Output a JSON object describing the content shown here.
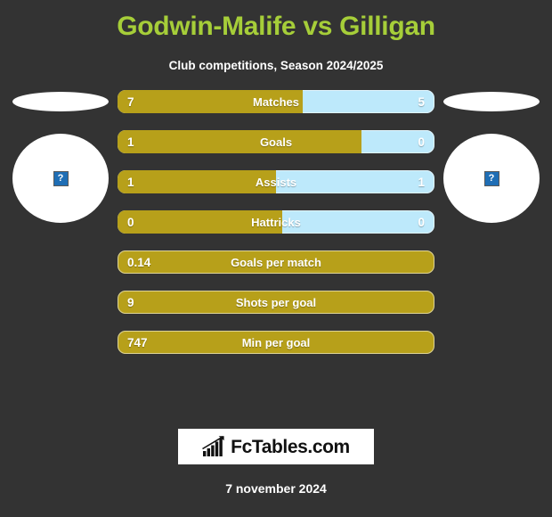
{
  "header": {
    "title": "Godwin-Malife vs Gilligan",
    "subtitle": "Club competitions, Season 2024/2025"
  },
  "colors": {
    "background": "#333333",
    "title": "#a6ce39",
    "home_bar": "#b7a01a",
    "away_bar": "#bde9fb",
    "text": "#ffffff",
    "plate": "#ffffff"
  },
  "players": {
    "home": {
      "name": "",
      "photo_placeholder": "broken-image",
      "photo_alt": "?"
    },
    "away": {
      "name": "",
      "photo_placeholder": "broken-image",
      "photo_alt": "?"
    }
  },
  "chart_data": {
    "type": "bar",
    "title": "Godwin-Malife vs Gilligan",
    "subtitle": "Club competitions, Season 2024/2025",
    "orientation": "horizontal-diverging",
    "series": [
      {
        "name": "Godwin-Malife",
        "side": "home",
        "color": "#b7a01a"
      },
      {
        "name": "Gilligan",
        "side": "away",
        "color": "#bde9fb"
      }
    ],
    "categories": [
      "Matches",
      "Goals",
      "Assists",
      "Hattricks",
      "Goals per match",
      "Shots per goal",
      "Min per goal"
    ],
    "rows": [
      {
        "label": "Matches",
        "home": "7",
        "away": "5",
        "home_pct": 58.3,
        "two_sided": true
      },
      {
        "label": "Goals",
        "home": "1",
        "away": "0",
        "home_pct": 77.0,
        "two_sided": true
      },
      {
        "label": "Assists",
        "home": "1",
        "away": "1",
        "home_pct": 50.0,
        "two_sided": true
      },
      {
        "label": "Hattricks",
        "home": "0",
        "away": "0",
        "home_pct": 52.0,
        "two_sided": true
      },
      {
        "label": "Goals per match",
        "home": "0.14",
        "away": "",
        "home_pct": 100,
        "two_sided": false
      },
      {
        "label": "Shots per goal",
        "home": "9",
        "away": "",
        "home_pct": 100,
        "two_sided": false
      },
      {
        "label": "Min per goal",
        "home": "747",
        "away": "",
        "home_pct": 100,
        "two_sided": false
      }
    ]
  },
  "footer": {
    "brand": "FcTables.com",
    "brand_icon": "bar-chart-growth-icon",
    "date": "7 november 2024"
  }
}
